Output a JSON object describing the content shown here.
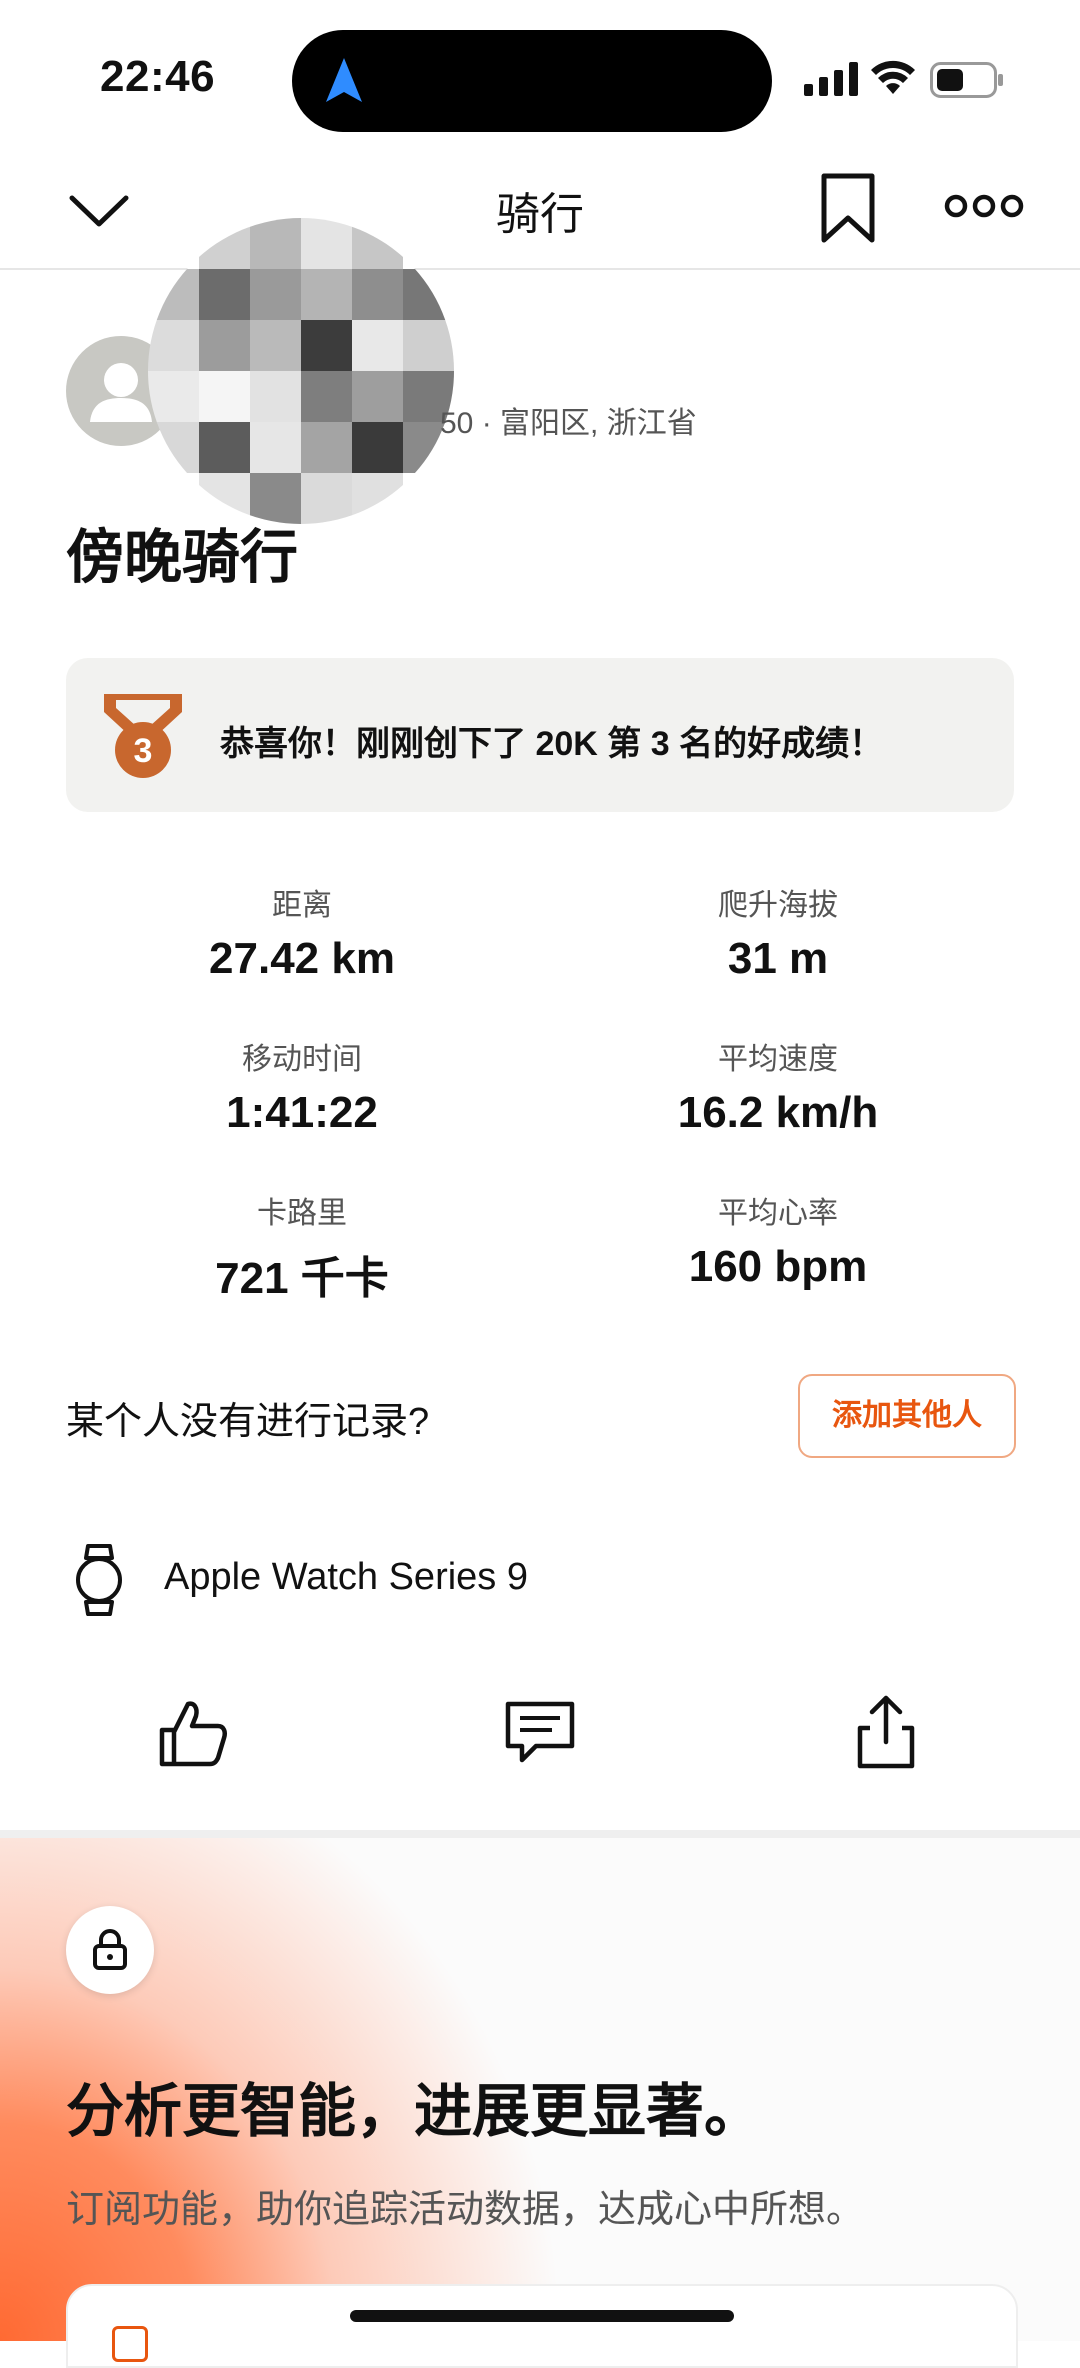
{
  "status_bar": {
    "time": "22:46"
  },
  "nav": {
    "title": "骑行"
  },
  "athlete": {
    "meta": "50 · 富阳区, 浙江省"
  },
  "activity": {
    "title": "傍晚骑行"
  },
  "achievement": {
    "text": "恭喜你！刚刚创下了 20K 第 3 名的好成绩！",
    "rank": "3",
    "medal_color": "#c8672e"
  },
  "stats": [
    {
      "label": "距离",
      "value": "27.42 km"
    },
    {
      "label": "爬升海拔",
      "value": "31 m"
    },
    {
      "label": "移动时间",
      "value": "1:41:22"
    },
    {
      "label": "平均速度",
      "value": "16.2 km/h"
    },
    {
      "label": "卡路里",
      "value": "721 千卡"
    },
    {
      "label": "平均心率",
      "value": "160 bpm"
    }
  ],
  "add_others": {
    "question": "某个人没有进行记录?",
    "button": "添加其他人"
  },
  "device": {
    "name": "Apple Watch Series 9",
    "icon": "watch-icon"
  },
  "actions": {
    "icons": [
      "like-icon",
      "comment-icon",
      "share-icon"
    ]
  },
  "promo": {
    "title": "分析更智能，进展更显著。",
    "subtitle": "订阅功能，助你追踪活动数据，达成心中所想。",
    "accent": "#fc5200"
  }
}
